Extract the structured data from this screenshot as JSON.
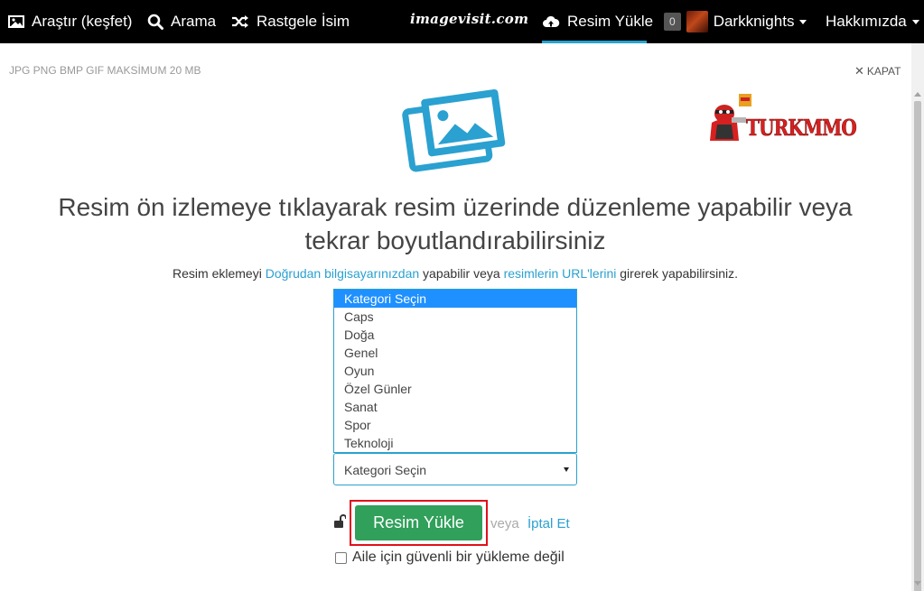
{
  "nav": {
    "explore": "Araştır (keşfet)",
    "search": "Arama",
    "random": "Rastgele İsim",
    "logo": "imagevisit.com",
    "upload": "Resim Yükle",
    "badge_count": "0",
    "username": "Darkknights",
    "about": "Hakkımızda"
  },
  "upload_panel": {
    "file_types": "JPG PNG BMP GIF  MAKSİMUM 20 MB",
    "close_label": "KAPAT",
    "brand_logo_text": "TURKMMO",
    "headline": "Resim ön izlemeye tıklayarak resim üzerinde düzenleme yapabilir veya tekrar boyutlandırabilirsiniz",
    "subtext": {
      "prefix": "Resim eklemeyi ",
      "link_computer": "Doğrudan bilgisayarınızdan",
      "middle": " yapabilir veya ",
      "link_url": "resimlerin URL'lerini",
      "suffix": " girerek yapabilirsiniz."
    },
    "category_options": [
      "Kategori Seçin",
      "Caps",
      "Doğa",
      "Genel",
      "Oyun",
      "Özel Günler",
      "Sanat",
      "Spor",
      "Teknoloji"
    ],
    "category_selected": "Kategori Seçin",
    "upload_button": "Resim Yükle",
    "or_text": "veya",
    "cancel_link": "İptal Et",
    "family_safe_label": "Aile için güvenli bir yükleme değil"
  },
  "colors": {
    "topbar_bg": "#000000",
    "accent_blue": "#2aa1d0",
    "upload_green": "#30a05a",
    "highlight_red": "#e0101a"
  }
}
